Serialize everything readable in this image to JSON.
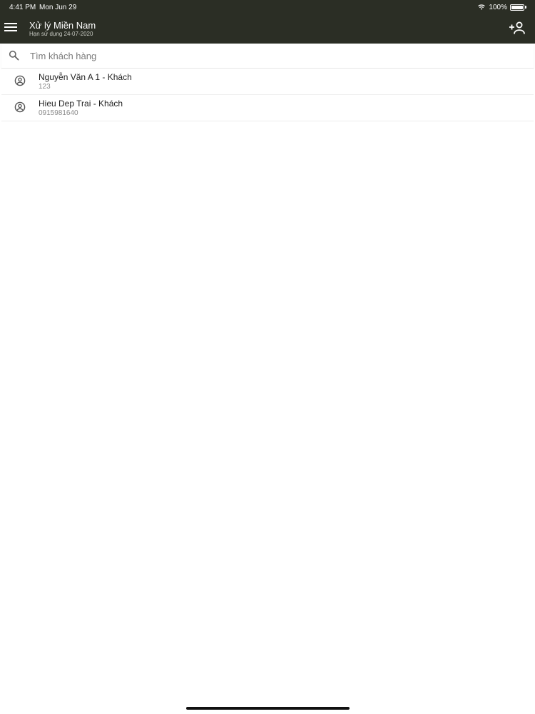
{
  "status_bar": {
    "time": "4:41 PM",
    "date": "Mon Jun 29",
    "battery": "100%",
    "icons": [
      "wifi-icon",
      "battery-icon"
    ]
  },
  "header": {
    "title": "Xử lý Miền Nam",
    "subtitle": "Hạn sử dụng 24-07-2020",
    "menu_icon": "hamburger-menu-icon",
    "add_icon": "add-user-icon"
  },
  "search": {
    "placeholder": "Tìm khách hàng",
    "value": "",
    "icon": "search-icon"
  },
  "customers": [
    {
      "name": "Nguyễn Văn A 1 - Khách",
      "phone": "123",
      "icon": "account-circle-icon"
    },
    {
      "name": "Hieu Dep Trai - Khách",
      "phone": "0915981640",
      "icon": "account-circle-icon"
    }
  ],
  "colors": {
    "header_bg": "#2b2e25",
    "header_text": "#ffffff",
    "page_bg": "#ffffff"
  }
}
